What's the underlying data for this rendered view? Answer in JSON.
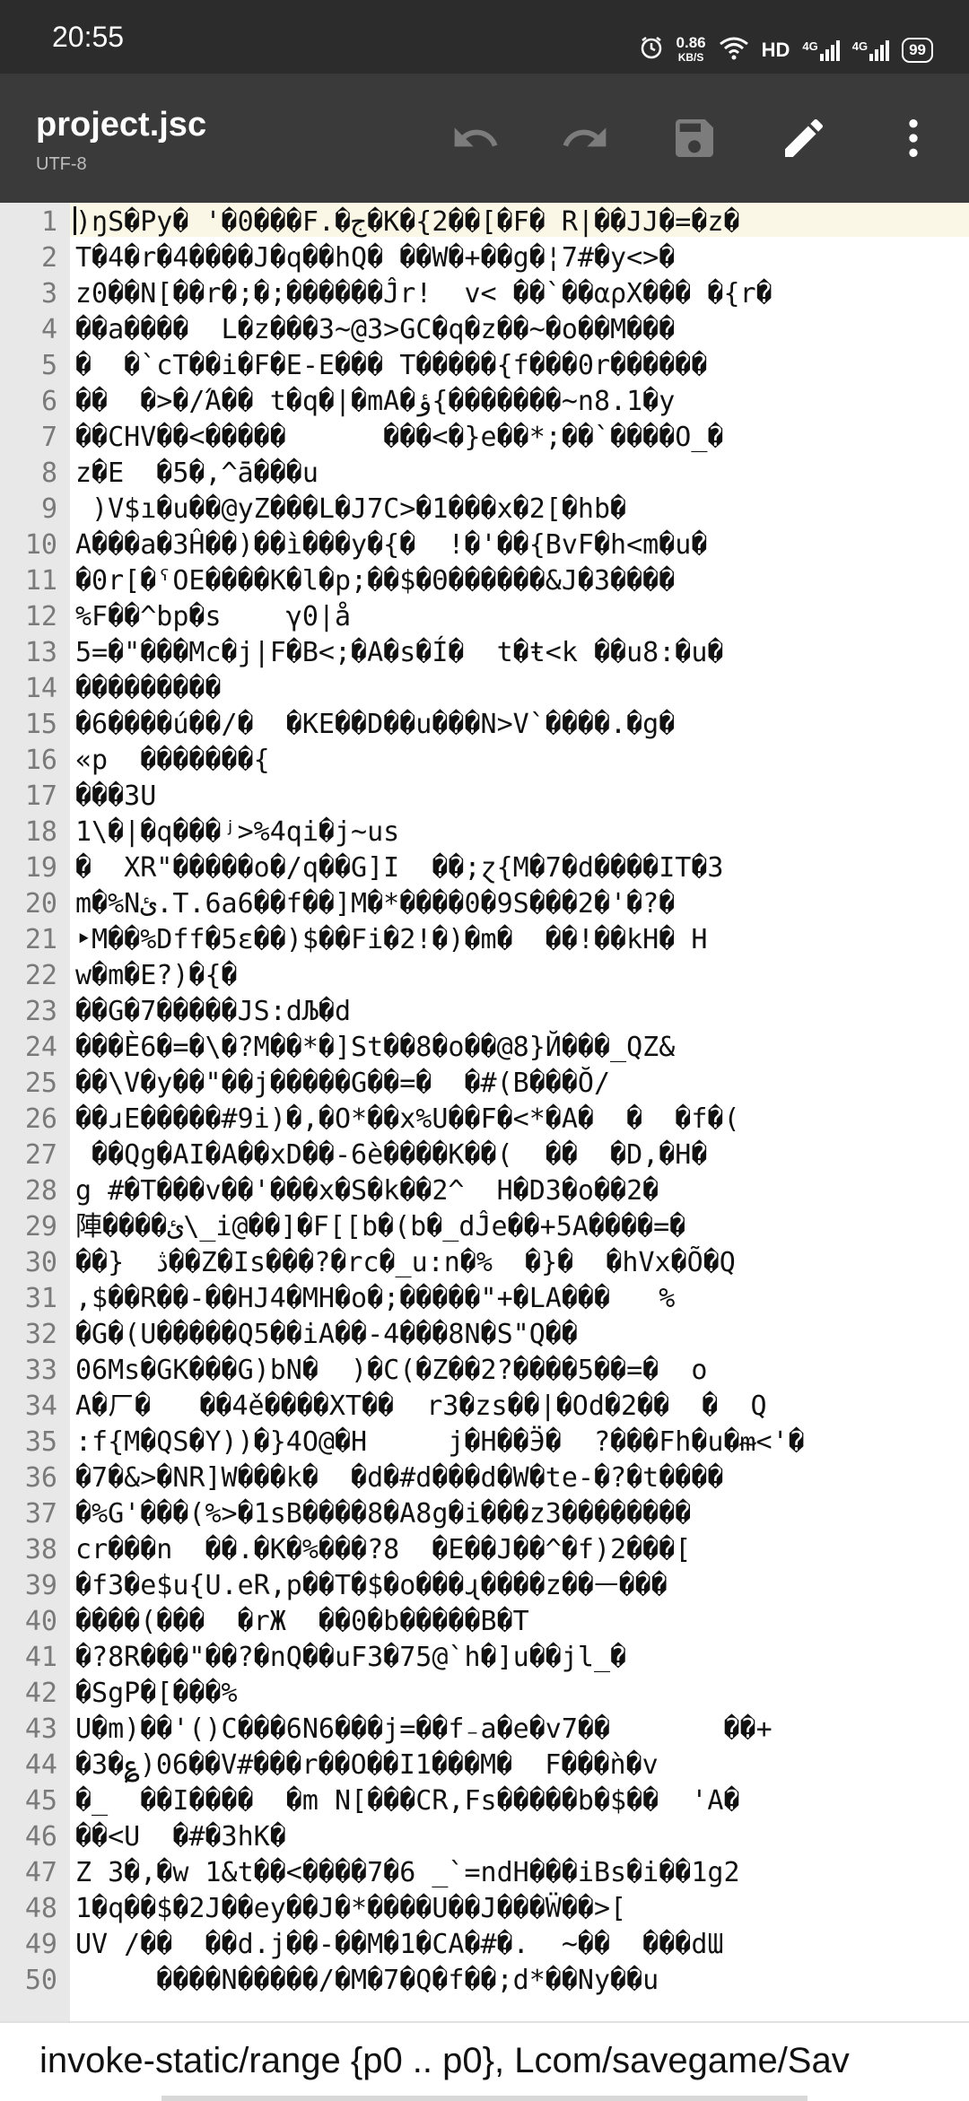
{
  "status_bar": {
    "time": "20:55",
    "net_speed_value": "0.86",
    "net_speed_unit": "KB/S",
    "hd_label": "HD",
    "signal1_label": "4G",
    "signal2_label": "4G",
    "battery": "99"
  },
  "app_bar": {
    "title": "project.jsc",
    "encoding": "UTF-8",
    "icons": [
      "undo-icon",
      "redo-icon",
      "save-icon",
      "edit-icon",
      "more-vert-icon"
    ]
  },
  "editor": {
    "highlight_color": "#fbf7e6",
    "lines": [
      {
        "n": "1",
        "text": ")ŋS�Py� '�0���F.�ج�K�{2��[�F� R|��JJ�=�z�"
      },
      {
        "n": "2",
        "text": "T�4�r�4����J�q��hQ� ��W�+��g�¦7#�y<>�"
      },
      {
        "n": "3",
        "text": "z0��N[��r�;�;������Ĵr!  v< ��`��αρX��� �{r�"
      },
      {
        "n": "4",
        "text": "��a����  L�z���3~@3>GC�q�z��~�o��M���"
      },
      {
        "n": "5",
        "text": "�  �`cT��i�F�E-E��� T�����{f���0r������"
      },
      {
        "n": "6",
        "text": "��  �>�/Ά�� t�q�|�mA�ؤ{�������~n8.1�y"
      },
      {
        "n": "7",
        "text": "��CHV��<�����      ���<�}e��*;��`����O_�"
      },
      {
        "n": "8",
        "text": "z�E  �5�,^ā���u"
      },
      {
        "n": "9",
        "text": " )V$ı�u��@yZ���L�J7C>�1���x�2[�hb�"
      },
      {
        "n": "10",
        "text": "A���a�3Ĥ��)��ì���y�{�  !�'��{BvF�h<m�u�"
      },
      {
        "n": "11",
        "text": "�0r[�ˤOE����K�l�p;��$�Θ������&J�3����"
      },
      {
        "n": "12",
        "text": "%F��^bp�s    γ0|å"
      },
      {
        "n": "13",
        "text": "5=�\"���Mc�j|F�B<;�A�s�Í�  t�ŧ<k ��u8:�u�"
      },
      {
        "n": "14",
        "text": "���������"
      },
      {
        "n": "15",
        "text": "�6����ú��/�  �KE��D��u���N>V`����.�g�"
      },
      {
        "n": "16",
        "text": "«p  �������{"
      },
      {
        "n": "17",
        "text": "���3U"
      },
      {
        "n": "18",
        "text": "1\\�|�q���ʲ>%4qi�j~us"
      },
      {
        "n": "19",
        "text": "�  XR\"�����o�/q��G]I  ��;ɀ{M�7�d����IT�3"
      },
      {
        "n": "20",
        "text": "m�%Nئ.T.6a6��f��]M�*����0�9S���2�'�?�"
      },
      {
        "n": "21",
        "text": "‣M��%Dff�5ɛ��)$��Fi�2!�)�m�  ��!��kH� H"
      },
      {
        "n": "22",
        "text": "w�m�E?)�{�"
      },
      {
        "n": "23",
        "text": "��G�7�����JS:dЉ�d"
      },
      {
        "n": "24",
        "text": "���È6�=�\\�?M��*�]St��8�o��@8}Й���_QZ&"
      },
      {
        "n": "25",
        "text": "��\\V�y��\"��j�����G��=�  �#(B���Ŏ/"
      },
      {
        "n": "26",
        "text": "��ɹE�����#9i)�,�O*��x%U��F�<*�A�  �  �f�(  "
      },
      {
        "n": "27",
        "text": " ��Qg�AI�A��xD��-6è����K��(  ��  �D,�H�"
      },
      {
        "n": "28",
        "text": "g #�T���v��'���x�S�k��2^  H�D3�o��2�"
      },
      {
        "n": "29",
        "text": "陣����ئ\\_i@��]�F[[b�(b�_dĴe��+5A����=�"
      },
      {
        "n": "30",
        "text": "��}  ڎ��Z�Is���?�rc�_u:n�%  �}�  �hVx�Õ�Q"
      },
      {
        "n": "31",
        "text": ",$��R��-��HJ4�MH�o�;�����\"+�LA���   %"
      },
      {
        "n": "32",
        "text": "�G�(U�����Q5��iA��-4���8N�S\"Q��"
      },
      {
        "n": "33",
        "text": "06Ms�GK���G)bN�  )�C(�Z��2?����5��=�  o"
      },
      {
        "n": "34",
        "text": "A�ㄏ�   ��4ě����XT��  r3�zs��|�Od�2��  �  Q"
      },
      {
        "n": "35",
        "text": ":f{M�QS�Y))�}4O@�H     j�H��Ӭ�  ?���Fh�u�ᵯ<'�"
      },
      {
        "n": "36",
        "text": "�7�&>�NR]W���k�  �d�#d���d�W�te-�?�t����"
      },
      {
        "n": "37",
        "text": "�%G'���(%>�1sB����8�A8g�i���z3��������"
      },
      {
        "n": "38",
        "text": "cr���n  ��.�K�%���?8  �E��J��^�f)2���["
      },
      {
        "n": "39",
        "text": "�f3�e$u{U.eR,p��T�$�o���ɻ����z��ᅳ���"
      },
      {
        "n": "40",
        "text": "����(���  �rЖ  ��0�b�����B�T"
      },
      {
        "n": "41",
        "text": "�?8R���\"��?�nQ��uF3�75@`h�]u��jl_�"
      },
      {
        "n": "42",
        "text": "�SgP�[���%"
      },
      {
        "n": "43",
        "text": "U�m)��'()C���6N6���j=��f₋a�e�v7��       ��+"
      },
      {
        "n": "44",
        "text": "�3�؏)06��V#���r��O��I1���M�  F���ǹ�v"
      },
      {
        "n": "45",
        "text": "�_  ��I����  �m N[���CR,Fs�����b�$��  'A�"
      },
      {
        "n": "46",
        "text": "��<U  �#�3hK�"
      },
      {
        "n": "47",
        "text": "Z 3�,�w 1&t��<����7�6 _`=ndH���iBs�i��1g2"
      },
      {
        "n": "48",
        "text": "1�q��$�2J��ey��J�*����U��J���Ẅ��>["
      },
      {
        "n": "49",
        "text": "UV /��  ��d.j��-��M�1�CA�#�.  ~��  ���dƜ"
      },
      {
        "n": "50",
        "text": "     ����N�����/�M�7�Q�f��;d*��Ny��u"
      }
    ]
  },
  "bottom": {
    "text": "invoke-static/range {p0 .. p0}, Lcom/savegame/Sav"
  }
}
